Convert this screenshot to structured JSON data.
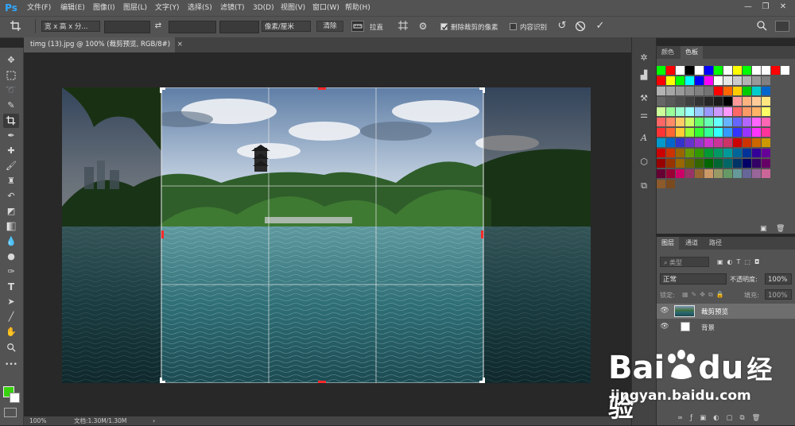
{
  "app": {
    "logo": "Ps"
  },
  "menu": [
    {
      "label": "文件(F)"
    },
    {
      "label": "编辑(E)"
    },
    {
      "label": "图像(I)"
    },
    {
      "label": "图层(L)"
    },
    {
      "label": "文字(Y)"
    },
    {
      "label": "选择(S)"
    },
    {
      "label": "滤镜(T)"
    },
    {
      "label": "3D(D)"
    },
    {
      "label": "视图(V)"
    },
    {
      "label": "窗口(W)"
    },
    {
      "label": "帮助(H)"
    }
  ],
  "window_controls": {
    "minimize": "—",
    "restore": "❐",
    "close": "✕"
  },
  "options": {
    "ratio_preset": "宽 x 高 x 分...",
    "swap_icon": "⇄",
    "unit_preset": "像素/厘米",
    "clear_label": "清除",
    "straighten_label": "拉直",
    "delete_cropped_label": "删除裁剪的像素",
    "delete_cropped_checked": true,
    "content_aware_label": "内容识别",
    "content_aware_checked": false
  },
  "document_tab": {
    "title": "timg (13).jpg @ 100% (裁剪预览, RGB/8#)",
    "close": "×"
  },
  "status": {
    "zoom": "100%",
    "doc_info": "文档:1.30M/1.30M",
    "arrow": "›"
  },
  "swatch_panel": {
    "tabs": [
      {
        "label": "颜色"
      },
      {
        "label": "色板"
      }
    ],
    "active_tab": "色板",
    "colors": [
      [
        "#00ff00",
        "#ff0000",
        "#ffffff",
        "#000000",
        "#ffffff",
        "#0000ff",
        "#00ff00",
        "#ffffff",
        "#ffff00",
        "#00ff00",
        "#ffffff",
        "#ffffff",
        "#ff0000",
        "#ffffff"
      ],
      [
        "#ff0000",
        "#ffff00",
        "#00ff00",
        "#00ffff",
        "#0000ff",
        "#ff00ff",
        "#ffffff",
        "#e6e6e6",
        "#cccccc",
        "#b3b3b3",
        "#999999",
        "#808080"
      ],
      [
        "#b3b3b3",
        "#a6a6a6",
        "#999999",
        "#8c8c8c",
        "#808080",
        "#737373",
        "#ff0000",
        "#ff6600",
        "#ffcc00",
        "#00cc00",
        "#00cccc",
        "#0066cc"
      ],
      [
        "#666666",
        "#595959",
        "#4d4d4d",
        "#404040",
        "#333333",
        "#262626",
        "#1a1a1a",
        "#000000",
        "#ff9999",
        "#ffb380",
        "#ffcc99",
        "#ffe680"
      ],
      [
        "#ccff99",
        "#99ff99",
        "#99ffcc",
        "#99ffff",
        "#99ccff",
        "#9999ff",
        "#cc99ff",
        "#ff99ff",
        "#ff6666",
        "#ff9966",
        "#ffb366",
        "#ffff66"
      ],
      [
        "#ff6666",
        "#ff8c66",
        "#ffcc66",
        "#ccff66",
        "#66ff66",
        "#66ffb3",
        "#66ffff",
        "#66b3ff",
        "#6666ff",
        "#b366ff",
        "#ff66ff",
        "#ff66b3"
      ],
      [
        "#ff3333",
        "#ff6633",
        "#ffcc33",
        "#99ff33",
        "#33ff33",
        "#33ff99",
        "#33ffff",
        "#3399ff",
        "#3333ff",
        "#9933ff",
        "#ff33ff",
        "#ff3399"
      ],
      [
        "#0099cc",
        "#0066cc",
        "#3333cc",
        "#6633cc",
        "#9933cc",
        "#cc33cc",
        "#cc3399",
        "#cc3366",
        "#cc0000",
        "#cc3300",
        "#cc6600",
        "#cc9900"
      ],
      [
        "#cc0000",
        "#cc3300",
        "#996600",
        "#669900",
        "#339900",
        "#009933",
        "#009966",
        "#009999",
        "#006699",
        "#003399",
        "#330099",
        "#660099"
      ],
      [
        "#990000",
        "#993300",
        "#996600",
        "#666600",
        "#336600",
        "#006600",
        "#006633",
        "#006666",
        "#003366",
        "#000066",
        "#330066",
        "#660066"
      ],
      [
        "#660033",
        "#990033",
        "#cc0066",
        "#993366",
        "#996633",
        "#cc9966",
        "#999966",
        "#669966",
        "#669999",
        "#666699",
        "#996699",
        "#cc6699"
      ],
      [
        "#8c5a2b",
        "#7a4a1f"
      ]
    ]
  },
  "layers_panel": {
    "tabs": [
      {
        "label": "图层"
      },
      {
        "label": "通道"
      },
      {
        "label": "路径"
      }
    ],
    "filter_label": "类型",
    "blend_mode": "正常",
    "opacity_label": "不透明度:",
    "opacity_value": "100%",
    "lock_label": "锁定:",
    "fill_label": "填充:",
    "fill_value": "100%",
    "layers": [
      {
        "name": "裁剪预览",
        "selected": true
      },
      {
        "name": "背景",
        "selected": false
      }
    ]
  },
  "watermark": {
    "brand_a": "Bai",
    "brand_b": "du",
    "brand_cn": "经验",
    "url": "jingyan.baidu.com"
  }
}
